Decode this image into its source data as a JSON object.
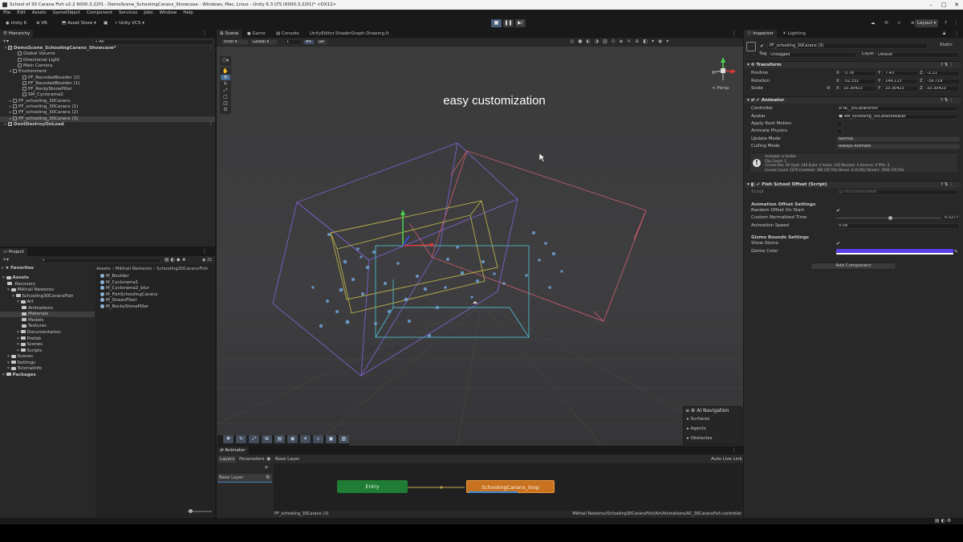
{
  "window": {
    "title": "School of 30 Carana Fish v2.2 6000.3.22f1 - DemoScene_SchoolingCaranx_Showcase - Windows, Mac, Linux - Unity 6.3 LTS (6000.3.22f1)* <DX12>"
  },
  "menu": [
    "File",
    "Edit",
    "Assets",
    "GameObject",
    "Component",
    "Services",
    "Jobs",
    "Window",
    "Help"
  ],
  "toolbar": {
    "account": "Unity 6",
    "vr": "VR",
    "asset_store": "Asset Store ▾",
    "vcs": "Unity VCS ▾",
    "layout": "Layout ▾"
  },
  "hierarchy": {
    "tab": "Hierarchy",
    "search_placeholder": "All",
    "items": [
      {
        "label": "DemoScene_SchoolingCaranx_Showcase*",
        "indent": 0,
        "fold": "▾",
        "scene": true
      },
      {
        "label": "Global Volume",
        "indent": 2
      },
      {
        "label": "Directional Light",
        "indent": 2
      },
      {
        "label": "Main Camera",
        "indent": 2
      },
      {
        "label": "Environment",
        "indent": 1,
        "fold": "▾"
      },
      {
        "label": "PF_RoundedBoulder (2)",
        "indent": 3
      },
      {
        "label": "PF_RoundedBoulder (1)",
        "indent": 3
      },
      {
        "label": "PF_RockyStonePillar",
        "indent": 3
      },
      {
        "label": "SM_Cyclorama2",
        "indent": 3
      },
      {
        "label": "PF_schooling_30Caranx",
        "indent": 1,
        "fold": "▸"
      },
      {
        "label": "PF_schooling_30Caranx (1)",
        "indent": 1,
        "fold": "▸"
      },
      {
        "label": "PF_schooling_30Caranx (2)",
        "indent": 1,
        "fold": "▸"
      },
      {
        "label": "PF_schooling_30Caranx (3)",
        "indent": 1,
        "fold": "▸",
        "selected": true
      },
      {
        "label": "DontDestroyOnLoad",
        "indent": 0,
        "fold": "▸",
        "scene": true
      }
    ]
  },
  "project": {
    "tab": "Project",
    "favorites": "Favorites",
    "tree": [
      {
        "label": "Assets",
        "indent": 0,
        "bold": true
      },
      {
        "label": ".Recovery",
        "indent": 1
      },
      {
        "label": "Mikhail Nesterov",
        "indent": 1
      },
      {
        "label": "Schooling30CaranxFish",
        "indent": 2
      },
      {
        "label": "Art",
        "indent": 3
      },
      {
        "label": "Animations",
        "indent": 4
      },
      {
        "label": "Materials",
        "indent": 4,
        "selected": true
      },
      {
        "label": "Models",
        "indent": 4
      },
      {
        "label": "Textures",
        "indent": 4
      },
      {
        "label": "Documentation",
        "indent": 3
      },
      {
        "label": "Prefab",
        "indent": 3
      },
      {
        "label": "Scenes",
        "indent": 3
      },
      {
        "label": "Scripts",
        "indent": 3
      },
      {
        "label": "Scenes",
        "indent": 1
      },
      {
        "label": "Settings",
        "indent": 1
      },
      {
        "label": "TutorialInfo",
        "indent": 1
      },
      {
        "label": "Packages",
        "indent": 0,
        "bold": true
      }
    ],
    "breadcrumb": "Assets › Mikhail Nesterov › Schooling30CaranxFish",
    "count": "21",
    "assets": [
      "M_Boulder",
      "M_Cyclorama1",
      "M_Cyclorama2_blur",
      "M_FishSchoolingCaranx",
      "M_OceanFloor",
      "M_RockyStonePillar"
    ]
  },
  "scene": {
    "tabs": [
      "Scene",
      "Game",
      "Console",
      "UnityEditor.ShaderGraph.Drawing.It"
    ],
    "pivot": "Pivot",
    "global": "Global",
    "frame": "1",
    "overlay_text": "easy customization",
    "persp": "< Persp",
    "ai_nav": {
      "title": "AI Navigation",
      "items": [
        "Surfaces",
        "Agents",
        "Obstacles"
      ]
    }
  },
  "animator": {
    "tab": "Animator",
    "layers_tab": "Layers",
    "params_tab": "Parameters",
    "breadcrumb": "Base Layer",
    "auto_live": "Auto Live Link",
    "layer": "Base Layer",
    "entry": "Entry",
    "state": "SchoolingCaranx_loop",
    "state_progress": 0.58,
    "footer_left": "PF_schooling_30Caranx (3)",
    "footer_right": "Mikhail Nesterov/Schooling30CaranxFish/Art/Animations/AC_30CaranxFish.controller"
  },
  "inspector": {
    "tabs": [
      "Inspector",
      "Lighting"
    ],
    "object_name": "PF_schooling_30Caranx (3)",
    "static": "Static",
    "tag_label": "Tag",
    "tag": "Untagged",
    "layer_label": "Layer",
    "layer": "Default",
    "transform": {
      "title": "Transform",
      "rows": [
        {
          "label": "Position",
          "x": "-3.78",
          "y": "7.43",
          "z": "-2.21"
        },
        {
          "label": "Rotation",
          "x": "-32.331",
          "y": "149.113",
          "z": "-39.719"
        },
        {
          "label": "Scale",
          "x": "10.30423",
          "y": "10.30423",
          "z": "10.30423"
        }
      ]
    },
    "animator": {
      "title": "Animator",
      "controller_label": "Controller",
      "controller": "AC_30CaranxFish",
      "avatar_label": "Avatar",
      "avatar": "AM_schooling_30CaranxAvatar",
      "root_motion": "Apply Root Motion",
      "physics": "Animate Physics",
      "update_label": "Update Mode",
      "update": "Normal",
      "culling_label": "Culling Mode",
      "culling": "Always Animate",
      "info": [
        "Animator is Visible",
        "Clip Count: 1",
        "Curves Pos: 30 Quat: 240 Euler: 0 Scale: 120 Muscles: 0 Generic: 0 PPtr: 0",
        "Curves Count: 1470 Constant: 360 (25.5%) Dense: 0 (0.0%) Stream: 1050 (74.5%)"
      ]
    },
    "script": {
      "title": "Fish School Offset (Script)",
      "script_label": "Script",
      "script": "FishSchoolOffset",
      "section1": "Animation Offset Settings",
      "random_label": "Random Offset On Start",
      "norm_label": "Custom Normalized Time",
      "norm": "0.5277",
      "speed_label": "Animation Speed",
      "speed": "0.58",
      "section2": "Gizmo Bounds Settings",
      "show_label": "Show Gizmo",
      "color_label": "Gizmo Color",
      "gizmo_color": "#5b3de8"
    },
    "add_component": "Add Component"
  }
}
